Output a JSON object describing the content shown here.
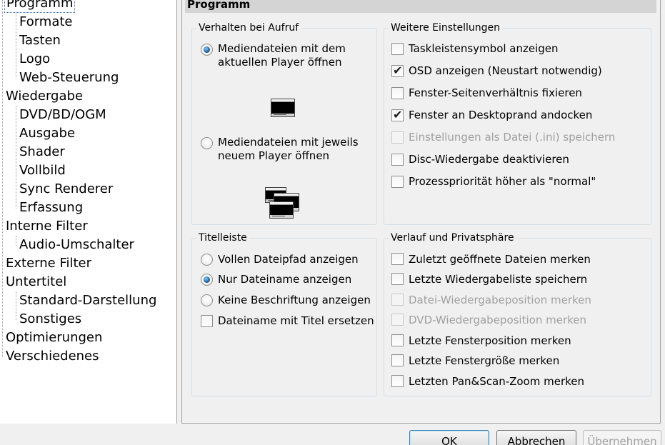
{
  "tree": {
    "items": [
      {
        "label": "Programm",
        "level": 0,
        "selected": true
      },
      {
        "label": "Formate",
        "level": 1
      },
      {
        "label": "Tasten",
        "level": 1
      },
      {
        "label": "Logo",
        "level": 1
      },
      {
        "label": "Web-Steuerung",
        "level": 1
      },
      {
        "label": "Wiedergabe",
        "level": 0
      },
      {
        "label": "DVD/BD/OGM",
        "level": 1
      },
      {
        "label": "Ausgabe",
        "level": 1
      },
      {
        "label": "Shader",
        "level": 1
      },
      {
        "label": "Vollbild",
        "level": 1
      },
      {
        "label": "Sync Renderer",
        "level": 1
      },
      {
        "label": "Erfassung",
        "level": 1
      },
      {
        "label": "Interne Filter",
        "level": 0
      },
      {
        "label": "Audio-Umschalter",
        "level": 1
      },
      {
        "label": "Externe Filter",
        "level": 0
      },
      {
        "label": "Untertitel",
        "level": 0
      },
      {
        "label": "Standard-Darstellung",
        "level": 1
      },
      {
        "label": "Sonstiges",
        "level": 1
      },
      {
        "label": "Optimierungen",
        "level": 0
      },
      {
        "label": "Verschiedenes",
        "level": 0
      }
    ]
  },
  "page": {
    "title": "Programm",
    "behavior": {
      "label": "Verhalten bei Aufruf",
      "option_current": "Mediendateien mit dem aktuellen Player öffnen",
      "option_current_line1": "Mediendateien mit dem",
      "option_current_line2": "aktuellen Player öffnen",
      "option_new_line1": "Mediendateien mit jeweils",
      "option_new_line2": "neuem Player öffnen",
      "selected": "current"
    },
    "further": {
      "label": "Weitere Einstellungen",
      "options": [
        {
          "label": "Taskleistensymbol anzeigen",
          "checked": false,
          "enabled": true
        },
        {
          "label": "OSD anzeigen (Neustart notwendig)",
          "checked": true,
          "enabled": true
        },
        {
          "label": "Fenster-Seitenverhältnis fixieren",
          "checked": false,
          "enabled": true
        },
        {
          "label": "Fenster an Desktoprand andocken",
          "checked": true,
          "enabled": true
        },
        {
          "label": "Einstellungen als Datei (.ini) speichern",
          "checked": false,
          "enabled": false
        },
        {
          "label": "Disc-Wiedergabe deaktivieren",
          "checked": false,
          "enabled": true
        },
        {
          "label": "Prozesspriorität höher als \"normal\"",
          "checked": false,
          "enabled": true
        }
      ]
    },
    "titlebar": {
      "label": "Titelleiste",
      "options": [
        {
          "label": "Vollen Dateipfad anzeigen",
          "checked": false
        },
        {
          "label": "Nur Dateiname anzeigen",
          "checked": true
        },
        {
          "label": "Keine Beschriftung anzeigen",
          "checked": false
        }
      ],
      "replace_label": "Dateiname mit Titel ersetzen",
      "replace_checked": false
    },
    "privacy": {
      "label": "Verlauf und Privatsphäre",
      "options": [
        {
          "label": "Zuletzt geöffnete Dateien merken",
          "checked": false,
          "enabled": true
        },
        {
          "label": "Letzte Wiedergabeliste speichern",
          "checked": false,
          "enabled": true
        },
        {
          "label": "Datei-Wiedergabeposition merken",
          "checked": false,
          "enabled": false
        },
        {
          "label": "DVD-Wiedergabeposition merken",
          "checked": false,
          "enabled": false
        },
        {
          "label": "Letzte Fensterposition merken",
          "checked": false,
          "enabled": true
        },
        {
          "label": "Letzte Fenstergröße merken",
          "checked": false,
          "enabled": true
        },
        {
          "label": "Letzten Pan&Scan-Zoom merken",
          "checked": false,
          "enabled": true
        }
      ]
    }
  },
  "buttons": {
    "ok": "OK",
    "cancel": "Abbrechen",
    "apply": "Übernehmen"
  },
  "colors": {
    "accent": "#3c7fb1",
    "disabled_text": "#a0a0a0"
  }
}
